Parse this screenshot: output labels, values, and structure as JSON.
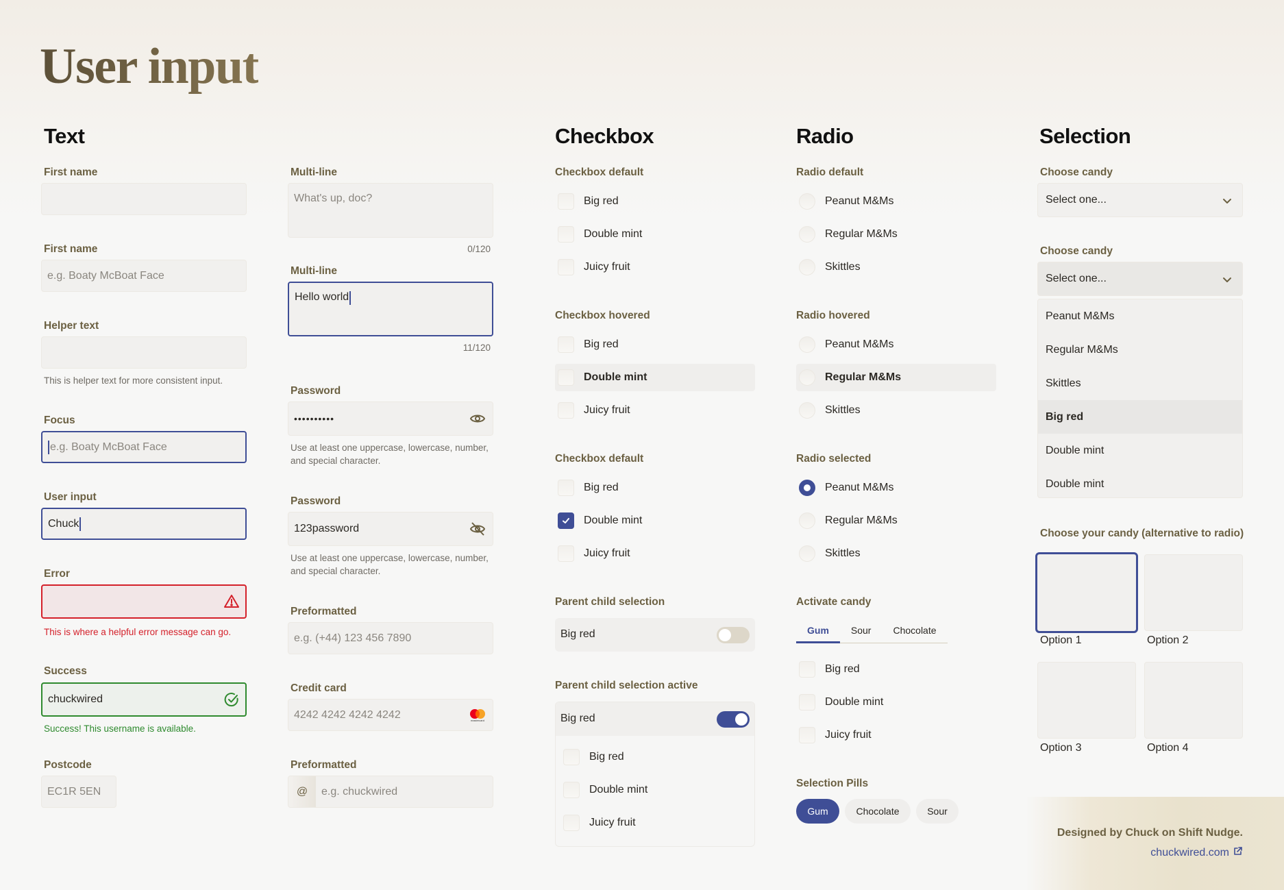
{
  "page": {
    "title": "User input"
  },
  "colors": {
    "accent": "#3f4e96",
    "error": "#d4202a",
    "success": "#2e8a2e",
    "label": "#6b6042"
  },
  "text_section": {
    "title": "Text",
    "first_name": {
      "label": "First name",
      "value": ""
    },
    "first_name_placeholder": {
      "label": "First name",
      "placeholder": "e.g. Boaty McBoat Face"
    },
    "helper": {
      "label": "Helper text",
      "value": "",
      "help": "This is helper text for more consistent input."
    },
    "focus": {
      "label": "Focus",
      "placeholder": "e.g. Boaty McBoat Face"
    },
    "user_input": {
      "label": "User input",
      "value": "Chuck"
    },
    "error": {
      "label": "Error",
      "value": "",
      "icon": "warning-triangle-icon",
      "message": "This is where a helpful error message can go."
    },
    "success": {
      "label": "Success",
      "value": "chuckwired",
      "icon": "check-circle-icon",
      "message": "Success! This username is available."
    },
    "postcode": {
      "label": "Postcode",
      "placeholder": "EC1R 5EN"
    },
    "multiline_empty": {
      "label": "Multi-line",
      "placeholder": "What's up, doc?",
      "counter": "0/120"
    },
    "multiline_filled": {
      "label": "Multi-line",
      "value": "Hello world",
      "counter": "11/120"
    },
    "password_hidden": {
      "label": "Password",
      "value": "••••••••••",
      "icon": "eye-icon",
      "help": "Use at least one uppercase, lowercase, number, and special character."
    },
    "password_shown": {
      "label": "Password",
      "value": "123password",
      "icon": "eye-off-icon",
      "help": "Use at least one uppercase, lowercase, number, and special character."
    },
    "phone": {
      "label": "Preformatted",
      "placeholder": "e.g. (+44) 123 456 7890"
    },
    "credit_card": {
      "label": "Credit card",
      "placeholder": "4242 4242 4242 4242",
      "icon": "mastercard-logo-icon",
      "brand_text": "mastercard"
    },
    "username": {
      "label": "Preformatted",
      "prefix": "@",
      "placeholder": "e.g. chuckwired"
    }
  },
  "checkbox_section": {
    "title": "Checkbox",
    "default": {
      "label": "Checkbox default",
      "items": [
        {
          "label": "Big red",
          "checked": false
        },
        {
          "label": "Double mint",
          "checked": false
        },
        {
          "label": "Juicy fruit",
          "checked": false
        }
      ]
    },
    "hovered": {
      "label": "Checkbox hovered",
      "items": [
        {
          "label": "Big red",
          "checked": false
        },
        {
          "label": "Double mint",
          "checked": false,
          "hovered": true
        },
        {
          "label": "Juicy fruit",
          "checked": false
        }
      ]
    },
    "checked": {
      "label": "Checkbox default",
      "items": [
        {
          "label": "Big red",
          "checked": false
        },
        {
          "label": "Double mint",
          "checked": true
        },
        {
          "label": "Juicy fruit",
          "checked": false
        }
      ]
    },
    "parent_child": {
      "label": "Parent child selection",
      "parent": "Big red",
      "toggle_on": false
    },
    "parent_child_active": {
      "label": "Parent child selection active",
      "parent": "Big red",
      "toggle_on": true,
      "children": [
        {
          "label": "Big red",
          "checked": false
        },
        {
          "label": "Double mint",
          "checked": false
        },
        {
          "label": "Juicy fruit",
          "checked": false
        }
      ]
    }
  },
  "radio_section": {
    "title": "Radio",
    "default": {
      "label": "Radio default",
      "items": [
        {
          "label": "Peanut M&Ms",
          "selected": false
        },
        {
          "label": "Regular M&Ms",
          "selected": false
        },
        {
          "label": "Skittles",
          "selected": false
        }
      ]
    },
    "hovered": {
      "label": "Radio hovered",
      "items": [
        {
          "label": "Peanut M&Ms",
          "selected": false
        },
        {
          "label": "Regular M&Ms",
          "selected": false,
          "hovered": true
        },
        {
          "label": "Skittles",
          "selected": false
        }
      ]
    },
    "selected": {
      "label": "Radio selected",
      "items": [
        {
          "label": "Peanut M&Ms",
          "selected": true
        },
        {
          "label": "Regular M&Ms",
          "selected": false
        },
        {
          "label": "Skittles",
          "selected": false
        }
      ]
    },
    "activate": {
      "label": "Activate candy",
      "tabs": [
        {
          "label": "Gum",
          "active": true
        },
        {
          "label": "Sour",
          "active": false
        },
        {
          "label": "Chocolate",
          "active": false
        }
      ],
      "items": [
        {
          "label": "Big red",
          "checked": false
        },
        {
          "label": "Double mint",
          "checked": false
        },
        {
          "label": "Juicy fruit",
          "checked": false
        }
      ]
    },
    "pills": {
      "label": "Selection Pills",
      "items": [
        {
          "label": "Gum",
          "active": true
        },
        {
          "label": "Chocolate",
          "active": false
        },
        {
          "label": "Sour",
          "active": false
        }
      ]
    }
  },
  "selection_section": {
    "title": "Selection",
    "select_closed": {
      "label": "Choose candy",
      "value": "Select one..."
    },
    "select_open": {
      "label": "Choose candy",
      "value": "Select one...",
      "options": [
        {
          "label": "Peanut M&Ms"
        },
        {
          "label": "Regular M&Ms"
        },
        {
          "label": "Skittles"
        },
        {
          "label": "Big red",
          "highlighted": true
        },
        {
          "label": "Double mint"
        },
        {
          "label": "Double mint"
        }
      ]
    },
    "cards": {
      "label": "Choose your candy (alternative to radio)",
      "options": [
        {
          "label": "Option 1",
          "selected": true
        },
        {
          "label": "Option 2"
        },
        {
          "label": "Option 3"
        },
        {
          "label": "Option 4"
        }
      ]
    }
  },
  "footer": {
    "credit": "Designed by Chuck on Shift Nudge.",
    "link": "chuckwired.com",
    "link_icon": "external-link-icon"
  }
}
